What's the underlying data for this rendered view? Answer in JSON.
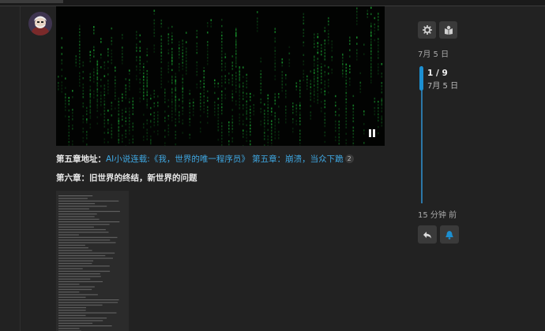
{
  "post": {
    "line1": {
      "label": "第五章地址：",
      "link_text": "AI小说连载:《我，世界的唯一程序员》 第五章：崩溃，当众下跪",
      "click_count": "2"
    },
    "line2": {
      "label": "第六章：旧世界的终结，新世界的问题"
    }
  },
  "timeline": {
    "top_date": "7月 5 日",
    "position": "1 / 9",
    "position_date": "7月 5 日",
    "bottom_date": "15 分钟 前"
  },
  "icons": {
    "settings": "gear-icon",
    "topic_map": "map-icon",
    "reply": "reply-icon",
    "notification": "bell-icon",
    "video_control": "pause-icon"
  },
  "colors": {
    "background": "#222222",
    "link": "#3fa8e3",
    "timeline_accent": "#1c8fd1",
    "matrix_green": "#1fbf3a"
  }
}
